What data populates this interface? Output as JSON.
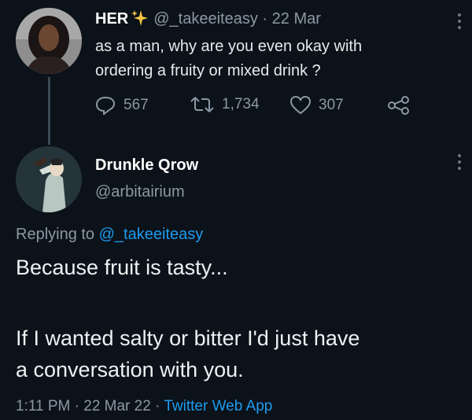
{
  "original_tweet": {
    "name": "HER",
    "badge_icon": "sparkles-icon",
    "handle": "@_takeeiteasy",
    "separator": "·",
    "date": "22 Mar",
    "text_line1": "as a man, why are you even okay with",
    "text_line2": "ordering a fruity or mixed drink ?",
    "replies": "567",
    "retweets": "1,734",
    "likes": "307"
  },
  "reply_tweet": {
    "name": "Drunkle Qrow",
    "handle": "@arbitairium",
    "replying_to_label": "Replying to",
    "replying_to_handle": "@_takeeiteasy",
    "line1": "Because fruit is tasty...",
    "line2": "If I wanted salty or bitter I'd just have",
    "line3": "a conversation with you.",
    "time": "1:11 PM",
    "date": "22 Mar 22",
    "source": "Twitter Web App"
  },
  "colors": {
    "background": "#0c1219",
    "text": "#e7e9ea",
    "muted": "#8b98a5",
    "link": "#1d9bf0",
    "sparkle": "#f5c542"
  }
}
